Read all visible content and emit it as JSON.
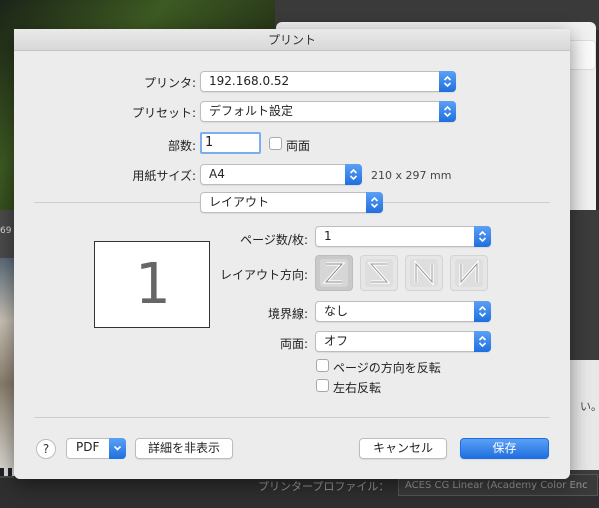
{
  "background": {
    "left_counter": "69",
    "right_text": "い。",
    "bottom_label": "プリンタープロファイル：",
    "bottom_value": "ACES CG Linear (Academy Color Enc"
  },
  "dialog": {
    "title": "プリント",
    "printer": {
      "label": "プリンタ:",
      "value": "192.168.0.52"
    },
    "preset": {
      "label": "プリセット:",
      "value": "デフォルト設定"
    },
    "copies": {
      "label": "部数:",
      "value": "1",
      "duplex_label": "両面"
    },
    "paper": {
      "label": "用紙サイズ:",
      "value": "A4",
      "size_note": "210 x 297 mm"
    },
    "section": {
      "value": "レイアウト"
    },
    "layout": {
      "preview_number": "1",
      "pages_per_sheet": {
        "label": "ページ数/枚:",
        "value": "1"
      },
      "direction": {
        "label": "レイアウト方向:",
        "selected_index": 0,
        "option_icons": [
          "z-layout-icon",
          "reverse-z-layout-icon",
          "n-layout-icon",
          "reverse-n-layout-icon"
        ]
      },
      "border": {
        "label": "境界線:",
        "value": "なし"
      },
      "two_sided": {
        "label": "両面:",
        "value": "オフ"
      },
      "reverse_orientation": {
        "label": "ページの方向を反転"
      },
      "flip_horizontal": {
        "label": "左右反転"
      }
    },
    "footer": {
      "help": "?",
      "pdf": "PDF",
      "hide_details": "詳細を非表示",
      "cancel": "キャンセル",
      "save": "保存"
    },
    "colors": {
      "accent": "#1f6fe0",
      "sheet_bg": "#ececec"
    }
  }
}
